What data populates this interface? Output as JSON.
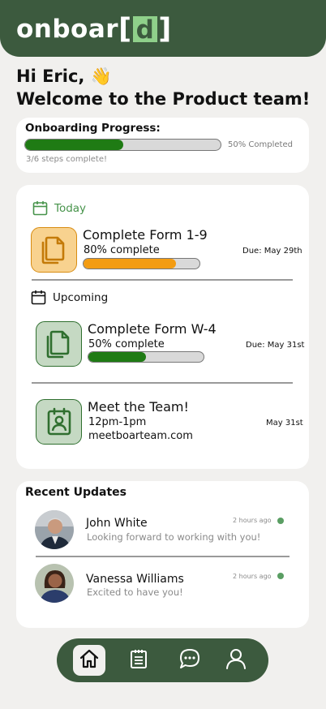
{
  "brand": {
    "logo_prefix": "onboar",
    "logo_open": "[",
    "logo_letter": "d",
    "logo_close": "]"
  },
  "greeting": {
    "line1": "Hi Eric, ",
    "wave": "👋",
    "line2": "Welcome to the Product team!"
  },
  "onboarding": {
    "title": "Onboarding Progress:",
    "progress_fraction": 0.5,
    "percent_text": "50%  Completed",
    "steps_text": "3/6 steps complete!"
  },
  "today": {
    "label": "Today",
    "task": {
      "title": "Complete Form 1-9",
      "progress_text": "80% complete",
      "progress_fraction": 0.8,
      "due": "Due: May 29th",
      "icon": "document-copy-icon"
    }
  },
  "upcoming": {
    "label": "Upcoming",
    "tasks": [
      {
        "title": "Complete Form W-4",
        "progress_text": "50% complete",
        "progress_fraction": 0.5,
        "due": "Due: May 31st",
        "icon": "document-copy-icon"
      }
    ],
    "meeting": {
      "title": "Meet the Team!",
      "time": "12pm-1pm",
      "link": "meetboarteam.com",
      "date": "May 31st",
      "icon": "id-badge-icon"
    }
  },
  "updates": {
    "title": "Recent Updates",
    "items": [
      {
        "name": "John White",
        "message": "Looking forward to working with you!",
        "time": "2 hours ago",
        "status": "online"
      },
      {
        "name": "Vanessa Williams",
        "message": "Excited to have you!",
        "time": "2 hours ago",
        "status": "online"
      }
    ]
  },
  "nav": {
    "items": [
      {
        "icon": "home-icon",
        "active": true
      },
      {
        "icon": "clipboard-icon",
        "active": false
      },
      {
        "icon": "chat-bubble-icon",
        "active": false
      },
      {
        "icon": "user-icon",
        "active": false
      }
    ]
  },
  "colors": {
    "brand_green": "#3c5a3e",
    "progress_green": "#1f7b14",
    "accent_orange": "#f39c12",
    "today_green": "#46934a",
    "status_dot": "#5a9e63"
  }
}
